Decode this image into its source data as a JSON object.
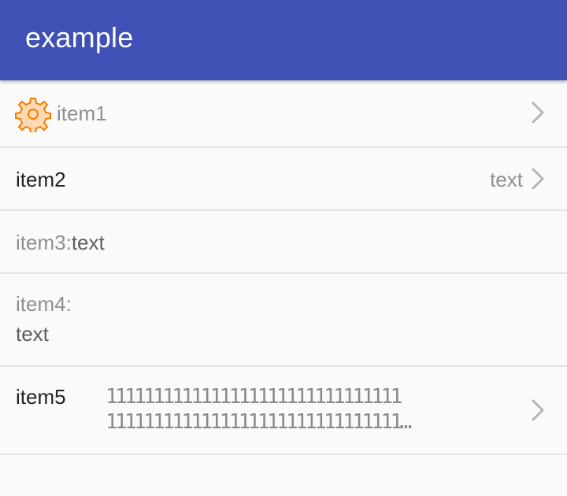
{
  "app": {
    "title": "example"
  },
  "colors": {
    "primary": "#3f51b5",
    "icon_orange": "#f57c00"
  },
  "items": [
    {
      "label": "item1",
      "icon": "gear-icon",
      "has_chevron": true
    },
    {
      "label": "item2",
      "value": "text",
      "has_chevron": true
    },
    {
      "label": "item3:",
      "value": "text"
    },
    {
      "label": "item4:",
      "value": "text"
    },
    {
      "label": "item5",
      "value_line1": "1111111111111111111111111111111",
      "value_line2": "1111111111111111111111111111111…",
      "has_chevron": true
    }
  ]
}
